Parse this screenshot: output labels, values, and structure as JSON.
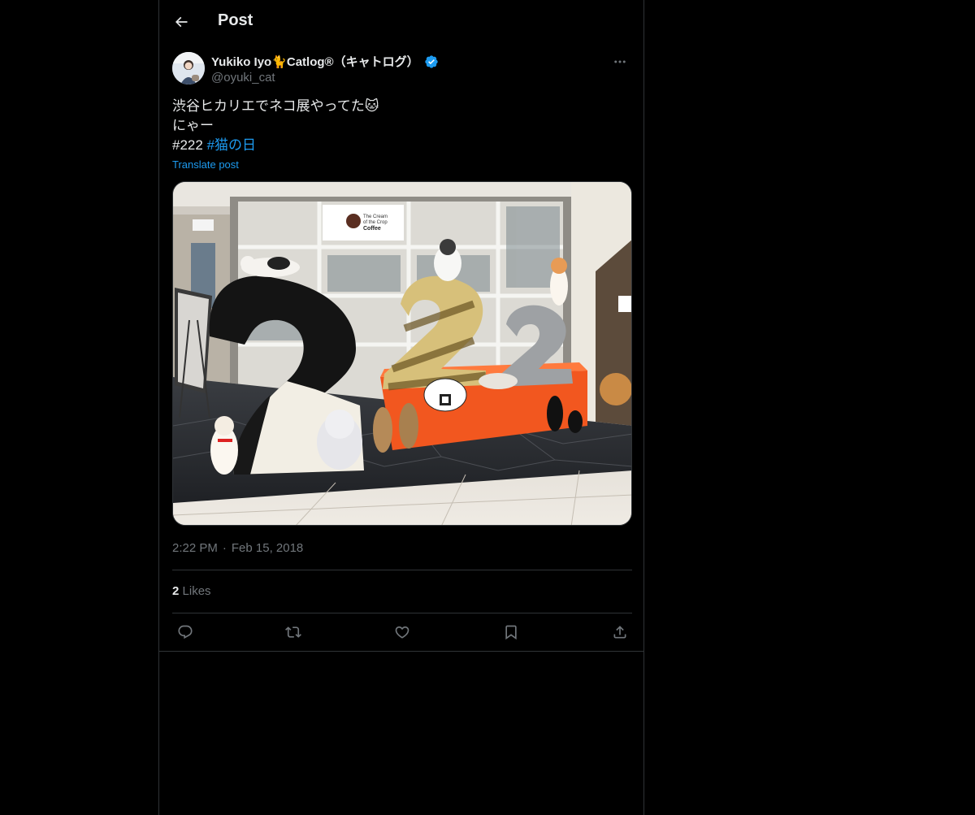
{
  "header": {
    "title": "Post",
    "back_icon": "arrow-left-icon"
  },
  "author": {
    "display_name": "Yukiko Iyo🐈Catlog®（キャトログ）",
    "handle": "@oyuki_cat",
    "verified": true
  },
  "post": {
    "lines": [
      "渋谷ヒカリエでネコ展やってた🐱",
      "にゃー"
    ],
    "tag_plain": "#222",
    "tag_link": "#猫の日",
    "translate_label": "Translate post"
  },
  "media": {
    "sign_line1": "The Cream",
    "sign_line2": "of the Crop",
    "sign_line3": "Coffee",
    "exhibit_number": "222"
  },
  "meta": {
    "time": "2:22 PM",
    "separator": "·",
    "date": "Feb 15, 2018"
  },
  "stats": {
    "likes_count": "2",
    "likes_label": "Likes"
  },
  "actions": [
    "reply-icon",
    "repost-icon",
    "like-icon",
    "bookmark-icon",
    "share-icon"
  ],
  "colors": {
    "background": "#000000",
    "text": "#e7e9ea",
    "muted": "#71767b",
    "accent": "#1d9bf0",
    "border": "#2f3336"
  }
}
